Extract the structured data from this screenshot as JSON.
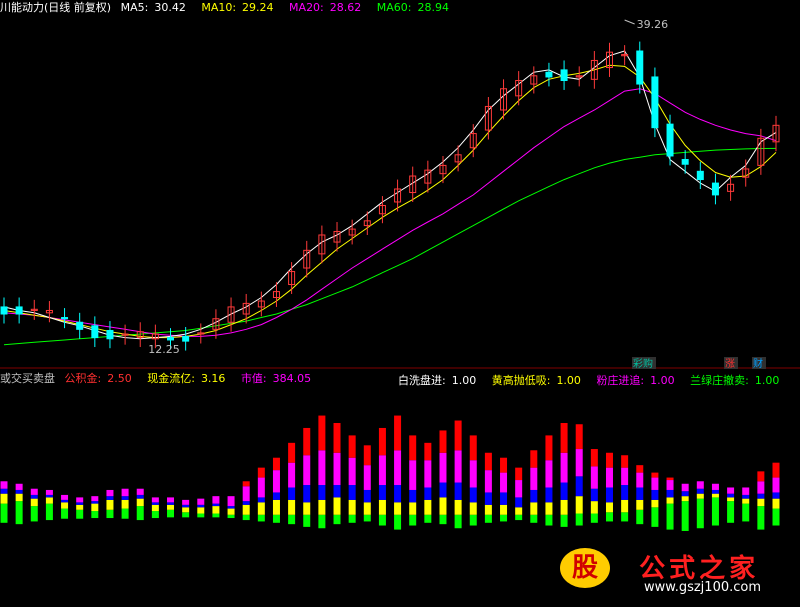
{
  "window": {
    "title": "川能动力(日线 前复权)"
  },
  "price_panel": {
    "legend": [
      {
        "label": "MA5:",
        "value": "30.42",
        "color": "#ffffff"
      },
      {
        "label": "MA10:",
        "value": "29.24",
        "color": "#ffff00"
      },
      {
        "label": "MA20:",
        "value": "28.62",
        "color": "#ff00ff"
      },
      {
        "label": "MA60:",
        "value": "28.94",
        "color": "#00ff00"
      }
    ],
    "high_marker": "39.26",
    "low_marker": "12.25",
    "tags": [
      {
        "text": "彩购",
        "color": "#00c0a0",
        "bg": "#303030"
      },
      {
        "text": "涨",
        "color": "#ff3030",
        "bg": "#303030"
      },
      {
        "text": "财",
        "color": "#00a0ff",
        "bg": "#303030"
      }
    ]
  },
  "indicator_panel": {
    "name": "或交买卖盘",
    "legend_left": [
      {
        "label": "公积金:",
        "value": "2.50",
        "color": "#ff3030"
      },
      {
        "label": "现金流亿:",
        "value": "3.16",
        "color": "#ffff00"
      },
      {
        "label": "市值:",
        "value": "384.05",
        "color": "#ff00ff"
      }
    ],
    "legend_right": [
      {
        "label": "白洗盘进:",
        "value": "1.00",
        "color": "#ffffff"
      },
      {
        "label": "黄高抛低吸:",
        "value": "1.00",
        "color": "#ffff00"
      },
      {
        "label": "粉庄进追:",
        "value": "1.00",
        "color": "#ff00ff"
      },
      {
        "label": "兰绿庄撤卖:",
        "value": "1.00",
        "color": "#00ff00"
      }
    ]
  },
  "watermark": {
    "logo_char": "股",
    "brand": "公式之家",
    "url": "www.gszj100.com"
  },
  "colors": {
    "up": "#ff3a3a",
    "down": "#00ffff",
    "ma5": "#ffffff",
    "ma10": "#ffff00",
    "ma20": "#ff00ff",
    "ma60": "#00ff00",
    "red": "#ff0000",
    "magenta": "#ff00ff",
    "yellow": "#ffff00",
    "blue": "#0000ff",
    "green": "#00ff00",
    "white": "#ffffff"
  },
  "chart_data": [
    {
      "type": "candlestick",
      "ylim": [
        11,
        40
      ],
      "ma5": [
        15.5,
        15.2,
        15.0,
        14.6,
        14.2,
        13.9,
        13.5,
        13.1,
        12.9,
        12.8,
        12.9,
        13.0,
        13.2,
        13.6,
        14.2,
        14.9,
        15.5,
        16.3,
        17.4,
        18.8,
        20.0,
        21.0,
        21.6,
        22.4,
        23.4,
        24.4,
        25.2,
        26.0,
        26.8,
        27.8,
        29.0,
        30.5,
        32.2,
        33.4,
        34.4,
        35.4,
        35.6,
        35.0,
        34.8,
        35.8,
        36.8,
        37.2,
        35.0,
        31.0,
        28.0,
        27.0,
        26.0,
        25.3,
        26.5,
        27.5,
        29.5,
        30.3
      ],
      "ma10": [
        15.2,
        15.0,
        14.8,
        14.6,
        14.3,
        14.0,
        13.7,
        13.4,
        13.2,
        13.0,
        12.9,
        12.9,
        13.0,
        13.2,
        13.5,
        14.0,
        14.5,
        15.2,
        16.0,
        17.0,
        18.2,
        19.3,
        20.4,
        21.3,
        22.2,
        23.1,
        23.9,
        24.6,
        25.4,
        26.3,
        27.5,
        28.8,
        30.3,
        31.7,
        33.0,
        34.1,
        34.8,
        35.1,
        35.3,
        35.6,
        36.0,
        35.9,
        35.0,
        33.2,
        31.0,
        29.2,
        27.9,
        26.9,
        26.5,
        26.6,
        27.4,
        28.6
      ],
      "ma20": [
        15.0,
        14.9,
        14.8,
        14.6,
        14.4,
        14.2,
        14.0,
        13.8,
        13.6,
        13.4,
        13.2,
        13.1,
        13.0,
        13.0,
        13.1,
        13.3,
        13.6,
        14.0,
        14.6,
        15.3,
        16.1,
        17.0,
        17.9,
        18.8,
        19.6,
        20.4,
        21.2,
        22.0,
        22.7,
        23.4,
        24.2,
        25.0,
        26.0,
        27.0,
        28.0,
        29.0,
        29.9,
        30.8,
        31.5,
        32.2,
        33.0,
        33.8,
        34.0,
        33.6,
        32.8,
        32.0,
        31.4,
        30.9,
        30.5,
        30.2,
        30.0,
        29.6
      ],
      "ma60": [
        12.3,
        12.4,
        12.5,
        12.6,
        12.7,
        12.8,
        12.9,
        13.0,
        13.1,
        13.2,
        13.3,
        13.4,
        13.5,
        13.7,
        13.9,
        14.1,
        14.3,
        14.6,
        14.9,
        15.3,
        15.7,
        16.2,
        16.7,
        17.2,
        17.8,
        18.4,
        19.0,
        19.6,
        20.3,
        21.0,
        21.7,
        22.4,
        23.1,
        23.8,
        24.5,
        25.1,
        25.7,
        26.3,
        26.8,
        27.3,
        27.7,
        28.0,
        28.2,
        28.4,
        28.5,
        28.6,
        28.7,
        28.8,
        28.85,
        28.9,
        28.93,
        28.94
      ]
    },
    {
      "type": "bar",
      "stacked": true,
      "ylim": [
        -100,
        100
      ],
      "series": [
        {
          "color": "#00ff00",
          "values": [
            10,
            12,
            8,
            10,
            6,
            5,
            4,
            5,
            6,
            8,
            4,
            5,
            3,
            2,
            2,
            1,
            1,
            1,
            1,
            1,
            1,
            1,
            1,
            1,
            1,
            1,
            1,
            1,
            1,
            1,
            1,
            1,
            1,
            1,
            1,
            1,
            1,
            1,
            2,
            2,
            3,
            3,
            5,
            7,
            10,
            12,
            14,
            15,
            12,
            10,
            8,
            6
          ]
        },
        {
          "color": "#ffff00",
          "values": [
            8,
            6,
            6,
            5,
            5,
            4,
            6,
            8,
            7,
            6,
            5,
            4,
            4,
            5,
            6,
            5,
            8,
            10,
            12,
            12,
            10,
            12,
            14,
            12,
            10,
            12,
            10,
            10,
            12,
            14,
            12,
            10,
            8,
            8,
            6,
            10,
            10,
            12,
            14,
            10,
            8,
            10,
            8,
            6,
            5,
            4,
            4,
            3,
            3,
            4,
            6,
            8
          ]
        },
        {
          "color": "#0000ff",
          "values": [
            4,
            3,
            3,
            2,
            2,
            2,
            2,
            3,
            3,
            3,
            2,
            2,
            2,
            2,
            2,
            2,
            3,
            4,
            6,
            10,
            14,
            12,
            10,
            12,
            10,
            12,
            14,
            10,
            10,
            12,
            14,
            12,
            10,
            10,
            8,
            10,
            12,
            14,
            16,
            10,
            12,
            12,
            10,
            8,
            6,
            4,
            4,
            3,
            3,
            3,
            4,
            5
          ]
        },
        {
          "color": "#ff00ff",
          "values": [
            6,
            5,
            5,
            4,
            4,
            4,
            4,
            5,
            6,
            5,
            4,
            4,
            4,
            5,
            6,
            8,
            12,
            16,
            18,
            20,
            24,
            28,
            26,
            22,
            20,
            24,
            28,
            24,
            22,
            24,
            26,
            22,
            18,
            16,
            14,
            18,
            22,
            24,
            22,
            18,
            16,
            14,
            12,
            10,
            8,
            6,
            6,
            5,
            5,
            6,
            10,
            12
          ]
        },
        {
          "color": "#ff0000",
          "values": [
            0,
            0,
            0,
            0,
            0,
            0,
            0,
            0,
            0,
            0,
            0,
            0,
            0,
            0,
            0,
            0,
            4,
            8,
            10,
            16,
            22,
            28,
            24,
            18,
            16,
            22,
            28,
            20,
            14,
            18,
            24,
            20,
            14,
            12,
            10,
            14,
            20,
            24,
            20,
            14,
            12,
            10,
            6,
            4,
            2,
            0,
            0,
            0,
            0,
            0,
            8,
            12
          ]
        }
      ],
      "negative": [
        -10,
        -12,
        -8,
        -6,
        -4,
        -4,
        -3,
        -3,
        -4,
        -6,
        -3,
        -2,
        -2,
        -2,
        -2,
        -3,
        -6,
        -8,
        -10,
        -12,
        -16,
        -18,
        -12,
        -10,
        -8,
        -14,
        -20,
        -14,
        -10,
        -12,
        -18,
        -14,
        -10,
        -8,
        -6,
        -10,
        -14,
        -16,
        -14,
        -10,
        -8,
        -8,
        -12,
        -16,
        -20,
        -22,
        -18,
        -14,
        -10,
        -8,
        -20,
        -14
      ]
    }
  ]
}
